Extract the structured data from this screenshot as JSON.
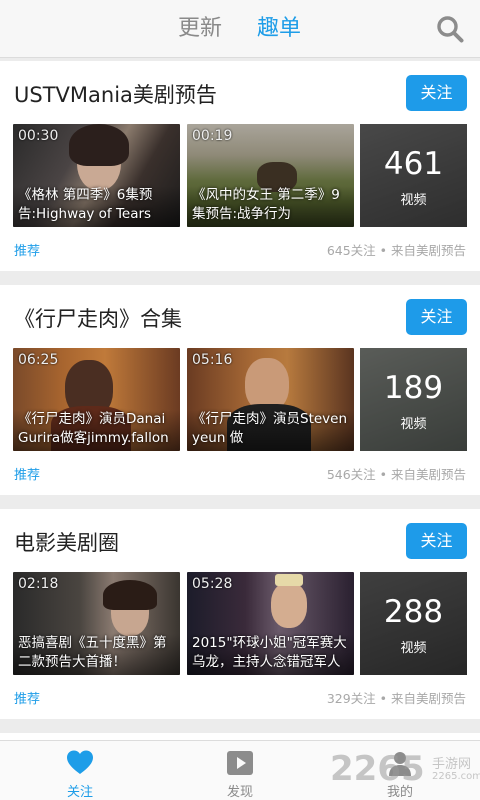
{
  "header": {
    "tab_update": "更新",
    "tab_qudan": "趣单",
    "icon": "search-icon",
    "accent": "#1e9de8"
  },
  "cards": [
    {
      "title": "USTVMania美剧预告",
      "follow_label": "关注",
      "videos": [
        {
          "duration": "00:30",
          "caption": "《格林 第四季》6集预告:Highway of Tears"
        },
        {
          "duration": "00:19",
          "caption": "《风中的女王 第二季》9集预告:战争行为"
        }
      ],
      "count": "461",
      "count_label": "视频",
      "tag": "推荐",
      "meta": "645关注 • 来自美剧预告"
    },
    {
      "title": "《行尸走肉》合集",
      "follow_label": "关注",
      "videos": [
        {
          "duration": "06:25",
          "caption": "《行尸走肉》演员Danai Gurira做客jimmy.fallon"
        },
        {
          "duration": "05:16",
          "caption": "《行尸走肉》演员Steven yeun 做"
        }
      ],
      "count": "189",
      "count_label": "视频",
      "tag": "推荐",
      "meta": "546关注 • 来自美剧预告"
    },
    {
      "title": "电影美剧圈",
      "follow_label": "关注",
      "videos": [
        {
          "duration": "02:18",
          "caption": "恶搞喜剧《五十度黑》第二款预告大首播！"
        },
        {
          "duration": "05:28",
          "caption": "2015\"环球小姐\"冠军赛大乌龙，主持人念错冠军人"
        }
      ],
      "count": "288",
      "count_label": "视频",
      "tag": "推荐",
      "meta": "329关注 • 来自美剧预告"
    }
  ],
  "bottom_nav": [
    {
      "label": "关注",
      "icon": "heart-icon",
      "active": true
    },
    {
      "label": "发现",
      "icon": "play-icon",
      "active": false
    },
    {
      "label": "我的",
      "icon": "user-icon",
      "active": false
    }
  ],
  "watermark": {
    "number": "2265",
    "suffix": "手游网",
    "domain": "2265.com"
  }
}
